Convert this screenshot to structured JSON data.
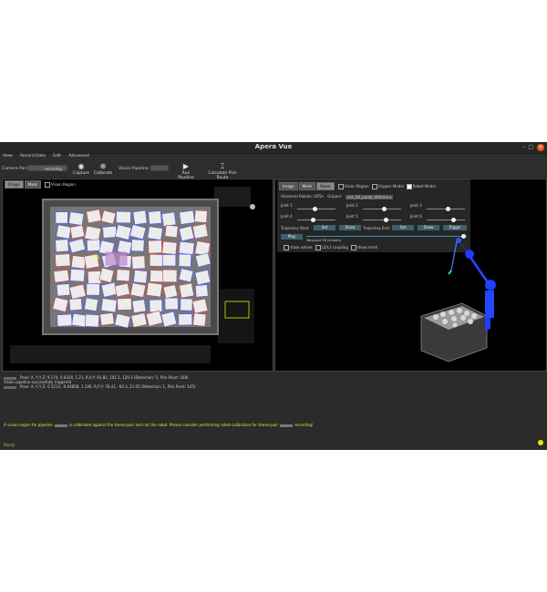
{
  "window": {
    "title": "Apera Vue"
  },
  "menu": [
    "View",
    "Record Data",
    "Edit",
    "Advanced"
  ],
  "toolbar": {
    "camera_pair_label": "Camera Pair:",
    "camera_pair_value": "recording",
    "capture_label": "Capture",
    "calibrate_label": "Calibrate",
    "vision_pipeline_label": "Vision Pipeline:",
    "run_pipeline_label": "Run Pipeline",
    "calculate_pick_label": "Calculate Pick Route"
  },
  "left_panel": {
    "tabs": [
      "Image",
      "Mask"
    ],
    "vision_region_label": "Vision Region"
  },
  "right_panel": {
    "tabs": [
      "Image",
      "Mesh",
      "Robot"
    ],
    "vision_region_label": "Vision Region",
    "gripper_model_label": "Gripper Model",
    "robot_model_label": "Robot Model",
    "universal_robots_label": "Universal Robots: UR5e",
    "gripper_label": "Gripper:",
    "gripper_value": "vac_4X_pump_400mm",
    "joints": [
      "Joint 1",
      "Joint 2",
      "Joint 3",
      "Joint 4",
      "Joint 5",
      "Joint 6"
    ],
    "joint_levels": [
      0.45,
      0.55,
      0.55,
      0.4,
      0.6,
      0.7
    ],
    "trajectory_start_label": "Trajectory Start",
    "trajectory_end_label": "Trajectory End",
    "set_label": "Set",
    "show_label": "Show",
    "trigger_label": "Trigger",
    "play_label": "Play",
    "waypoint_label": "Waypoint 56 (stream)",
    "play_progress": 0.98,
    "show_values_label": "show values",
    "l2l3_coupling_label": "L2/L3 coupling",
    "show_mesh_label": "show mesh"
  },
  "console": {
    "lines": [
      "Pose: X, Y,Y,Z: 9.174, 0.0324, 1.21,   R,P,Y: 91.82, 101.1,  129.3 (Detection: 5, Pick Point: 168)",
      "Vision pipeline successfully triggered",
      "Pose: X, Y,Y,Z: 0.1213, -0.04858, 1.240,   R,P,Y: 78.41, -60.3, 21.05 (Detection: 1, Pick Point: 145)"
    ],
    "warning_prefix": "A vision-region for pipeline",
    "warning_middle": "is calibrated against the stereo-pair and not the robot. Please consider performing robot-calibration for stereo-pair",
    "warning_suffix": "recording!",
    "status": "Ready"
  },
  "colors": {
    "accent_button": "#3f5f69",
    "robot_arm": "#1f3cff",
    "warning_text": "#e5e52a",
    "status_indicator": "#e6e600",
    "close_button": "#e95420"
  }
}
